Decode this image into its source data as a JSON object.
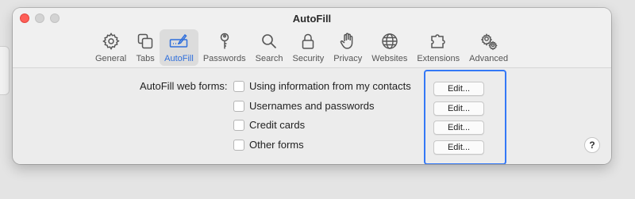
{
  "window": {
    "title": "AutoFill"
  },
  "toolbar": {
    "items": [
      {
        "label": "General",
        "icon": "gear-icon"
      },
      {
        "label": "Tabs",
        "icon": "tabs-icon"
      },
      {
        "label": "AutoFill",
        "icon": "autofill-icon",
        "active": true
      },
      {
        "label": "Passwords",
        "icon": "key-icon"
      },
      {
        "label": "Search",
        "icon": "search-icon"
      },
      {
        "label": "Security",
        "icon": "lock-icon"
      },
      {
        "label": "Privacy",
        "icon": "hand-icon"
      },
      {
        "label": "Websites",
        "icon": "globe-icon"
      },
      {
        "label": "Extensions",
        "icon": "puzzle-icon"
      },
      {
        "label": "Advanced",
        "icon": "gears-icon"
      }
    ]
  },
  "autofill": {
    "label": "AutoFill web forms:",
    "options": [
      {
        "label": "Using information from my contacts",
        "checked": false,
        "edit": "Edit..."
      },
      {
        "label": "Usernames and passwords",
        "checked": false,
        "edit": "Edit..."
      },
      {
        "label": "Credit cards",
        "checked": false,
        "edit": "Edit..."
      },
      {
        "label": "Other forms",
        "checked": false,
        "edit": "Edit..."
      }
    ]
  },
  "help": {
    "label": "?"
  },
  "colors": {
    "accent": "#3478f6",
    "close": "#fe5f57"
  }
}
